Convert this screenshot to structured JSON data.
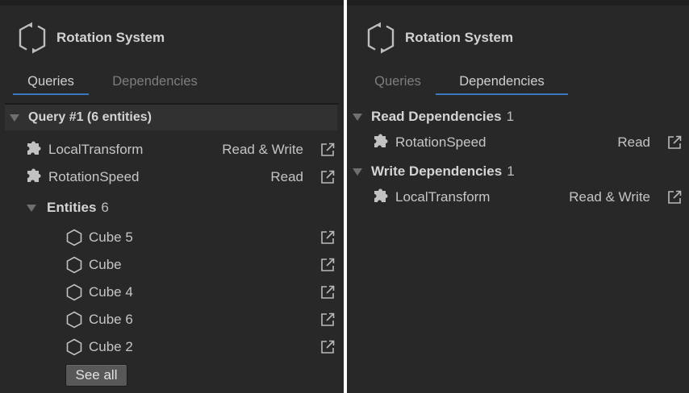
{
  "left": {
    "title": "Rotation System",
    "tabs": [
      "Queries",
      "Dependencies"
    ],
    "query": {
      "label": "Query #1 (6 entities)",
      "components": [
        {
          "name": "LocalTransform",
          "access": "Read & Write"
        },
        {
          "name": "RotationSpeed",
          "access": "Read"
        }
      ],
      "entities_label": "Entities",
      "entities_count": "6",
      "entities": [
        "Cube 5",
        "Cube",
        "Cube 4",
        "Cube 6",
        "Cube 2"
      ],
      "see_all": "See all"
    }
  },
  "right": {
    "title": "Rotation System",
    "tabs": [
      "Queries",
      "Dependencies"
    ],
    "read_deps": {
      "label": "Read Dependencies",
      "count": "1",
      "items": [
        {
          "name": "RotationSpeed",
          "access": "Read"
        }
      ]
    },
    "write_deps": {
      "label": "Write Dependencies",
      "count": "1",
      "items": [
        {
          "name": "LocalTransform",
          "access": "Read & Write"
        }
      ]
    }
  },
  "colors": {
    "panel_bg": "#282828",
    "accent": "#3a79bb",
    "text": "#c4c4c4"
  }
}
